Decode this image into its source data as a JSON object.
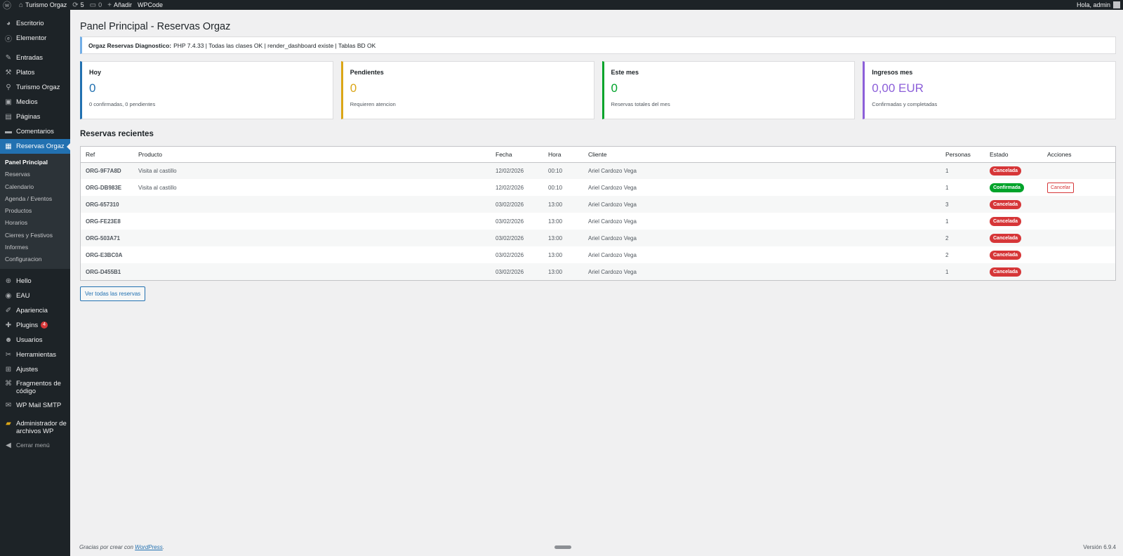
{
  "adminbar": {
    "site_name": "Turismo Orgaz",
    "updates_count": "5",
    "comments_count": "0",
    "add_new": "Añadir",
    "wpcode": "WPCode",
    "greeting": "Hola, admin"
  },
  "sidebar": {
    "items_top": [
      {
        "label": "Escritorio",
        "icon": "dashboard-icon",
        "glyph": "◕"
      },
      {
        "label": "Elementor",
        "icon": "elementor-icon",
        "glyph": "ⓔ"
      }
    ],
    "items_content": [
      {
        "label": "Entradas",
        "icon": "pin-icon",
        "glyph": "✎"
      },
      {
        "label": "Platos",
        "icon": "hammer-icon",
        "glyph": "⚒"
      },
      {
        "label": "Turismo Orgaz",
        "icon": "location-icon",
        "glyph": "⚲"
      },
      {
        "label": "Medios",
        "icon": "media-icon",
        "glyph": "▣"
      },
      {
        "label": "Páginas",
        "icon": "pages-icon",
        "glyph": "▤"
      },
      {
        "label": "Comentarios",
        "icon": "comments-icon",
        "glyph": "▬"
      }
    ],
    "active_item": {
      "label": "Reservas Orgaz",
      "icon": "calendar-icon",
      "glyph": "▦"
    },
    "submenu": [
      "Panel Principal",
      "Reservas",
      "Calendario",
      "Agenda / Eventos",
      "Productos",
      "Horarios",
      "Cierres y Festivos",
      "Informes",
      "Configuracion"
    ],
    "items_bottom": [
      {
        "label": "Hello",
        "icon": "plus-circle-icon",
        "glyph": "⊕"
      },
      {
        "label": "EAU",
        "icon": "eau-icon",
        "glyph": "◉"
      },
      {
        "label": "Apariencia",
        "icon": "brush-icon",
        "glyph": "✐"
      },
      {
        "label": "Plugins",
        "icon": "plugin-icon",
        "glyph": "✚",
        "badge": "4"
      },
      {
        "label": "Usuarios",
        "icon": "user-icon",
        "glyph": "☻"
      },
      {
        "label": "Herramientas",
        "icon": "wrench-icon",
        "glyph": "✂"
      },
      {
        "label": "Ajustes",
        "icon": "settings-icon",
        "glyph": "⊞"
      }
    ],
    "fragmentos": {
      "line1": "Fragmentos de",
      "line2": "código",
      "icon": "code-icon",
      "glyph": "⌘"
    },
    "wpmail": {
      "label": "WP Mail SMTP",
      "icon": "mail-icon",
      "glyph": "✉"
    },
    "admin_archivos": {
      "line1": "Administrador de",
      "line2": "archivos WP",
      "icon": "folder-icon",
      "glyph": "▰"
    },
    "collapse": {
      "label": "Cerrar menú",
      "icon": "collapse-icon",
      "glyph": "◀"
    }
  },
  "page": {
    "title": "Panel Principal - Reservas Orgaz",
    "notice_strong": "Orgaz Reservas Diagnostico:",
    "notice_text": "PHP 7.4.33 | Todas las clases OK | render_dashboard existe | Tablas BD OK"
  },
  "cards": [
    {
      "title": "Hoy",
      "value": "0",
      "sub": "0 confirmadas, 0 pendientes",
      "color": "#2271b1"
    },
    {
      "title": "Pendientes",
      "value": "0",
      "sub": "Requieren atencion",
      "color": "#dba617"
    },
    {
      "title": "Este mes",
      "value": "0",
      "sub": "Reservas totales del mes",
      "color": "#00a32a"
    },
    {
      "title": "Ingresos mes",
      "value": "0,00 EUR",
      "sub": "Confirmadas y completadas",
      "color": "#8c5fd9"
    }
  ],
  "recent": {
    "title": "Reservas recientes",
    "columns": [
      "Ref",
      "Producto",
      "Fecha",
      "Hora",
      "Cliente",
      "Personas",
      "Estado",
      "Acciones"
    ],
    "rows": [
      {
        "ref": "ORG-9F7A8D",
        "producto": "Visita al castillo",
        "fecha": "12/02/2026",
        "hora": "00:10",
        "cliente": "Ariel Cardozo Vega",
        "personas": "1",
        "estado": "Cancelada",
        "accion": ""
      },
      {
        "ref": "ORG-DB983E",
        "producto": "Visita al castillo",
        "fecha": "12/02/2026",
        "hora": "00:10",
        "cliente": "Ariel Cardozo Vega",
        "personas": "1",
        "estado": "Confirmada",
        "accion": "Cancelar"
      },
      {
        "ref": "ORG-657310",
        "producto": "",
        "fecha": "03/02/2026",
        "hora": "13:00",
        "cliente": "Ariel Cardozo Vega",
        "personas": "3",
        "estado": "Cancelada",
        "accion": ""
      },
      {
        "ref": "ORG-FE23E8",
        "producto": "",
        "fecha": "03/02/2026",
        "hora": "13:00",
        "cliente": "Ariel Cardozo Vega",
        "personas": "1",
        "estado": "Cancelada",
        "accion": ""
      },
      {
        "ref": "ORG-503A71",
        "producto": "",
        "fecha": "03/02/2026",
        "hora": "13:00",
        "cliente": "Ariel Cardozo Vega",
        "personas": "2",
        "estado": "Cancelada",
        "accion": ""
      },
      {
        "ref": "ORG-E3BC0A",
        "producto": "",
        "fecha": "03/02/2026",
        "hora": "13:00",
        "cliente": "Ariel Cardozo Vega",
        "personas": "2",
        "estado": "Cancelada",
        "accion": ""
      },
      {
        "ref": "ORG-D455B1",
        "producto": "",
        "fecha": "03/02/2026",
        "hora": "13:00",
        "cliente": "Ariel Cardozo Vega",
        "personas": "1",
        "estado": "Cancelada",
        "accion": ""
      }
    ],
    "view_all": "Ver todas las reservas"
  },
  "footer": {
    "thanks_prefix": "Gracias por crear con",
    "wordpress_link": "WordPress",
    "thanks_suffix": ".",
    "version": "Versión 6.9.4"
  }
}
